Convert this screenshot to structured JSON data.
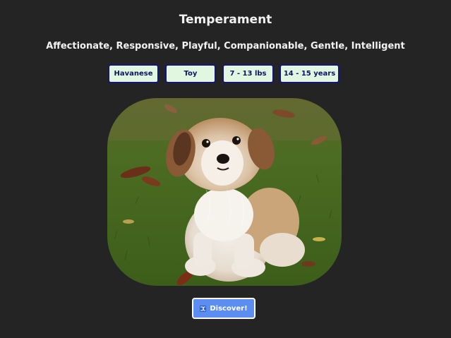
{
  "header": {
    "title": "Temperament",
    "temperament_text": "Affectionate, Responsive, Playful, Companionable, Gentle, Intelligent"
  },
  "tags": [
    {
      "label": "Havanese"
    },
    {
      "label": "Toy"
    },
    {
      "label": "7 - 13 lbs"
    },
    {
      "label": "14 - 15 years"
    }
  ],
  "photo": {
    "subject": "dog-photo"
  },
  "actions": {
    "discover_label": "Discover!",
    "discover_icon": "shuffle-icon"
  },
  "colors": {
    "background": "#242424",
    "tag_fill": "#e1f7df",
    "tag_border": "#16167a",
    "button_fill": "#5b8ef0"
  }
}
